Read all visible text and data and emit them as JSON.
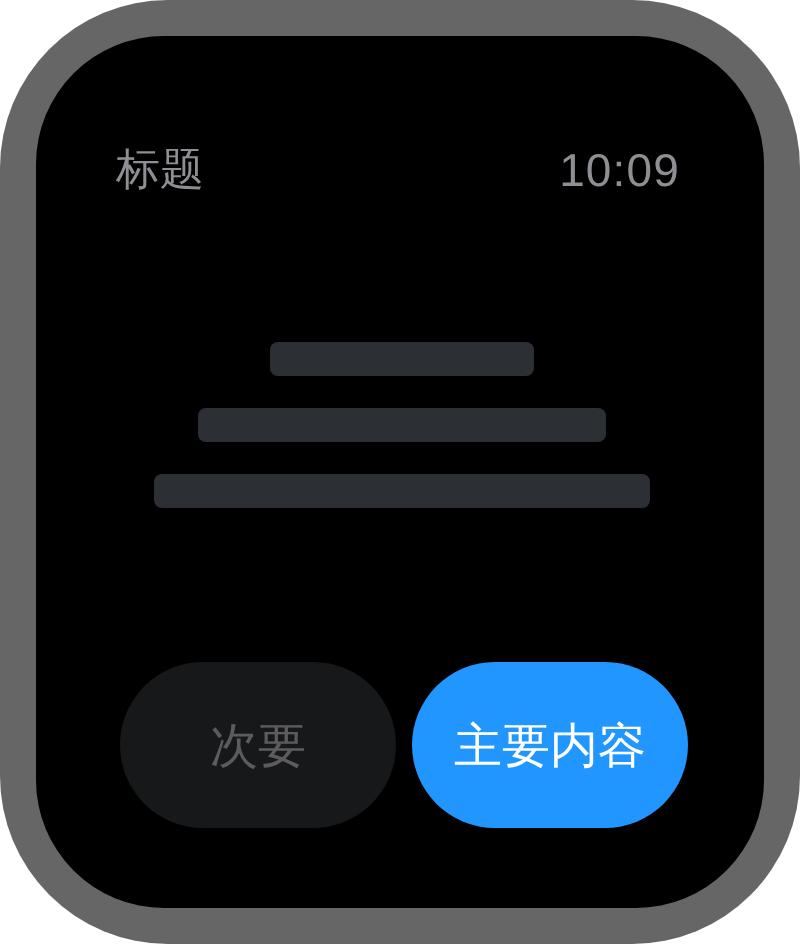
{
  "header": {
    "title": "标题",
    "time": "10:09"
  },
  "buttons": [
    {
      "label": "次要",
      "kind": "secondary",
      "disabled": true
    },
    {
      "label": "主要内容",
      "kind": "primary",
      "disabled": false
    }
  ]
}
